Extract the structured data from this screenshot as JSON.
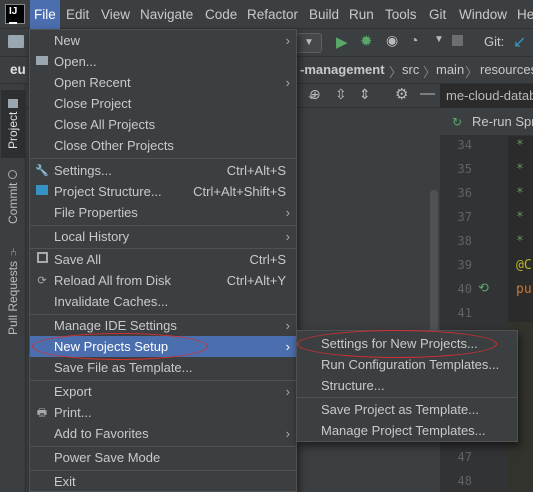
{
  "menubar": {
    "logo": "IJ",
    "items": [
      "File",
      "Edit",
      "View",
      "Navigate",
      "Code",
      "Refactor",
      "Build",
      "Run",
      "Tools",
      "Git",
      "Window",
      "He"
    ]
  },
  "toolbar": {
    "git_label": "Git:"
  },
  "breadcrumbs": {
    "items": [
      "-management",
      "src",
      "main",
      "resources"
    ]
  },
  "project_root": "eu",
  "left_strip": {
    "tabs": [
      "Project",
      "Commit",
      "Pull Requests"
    ]
  },
  "editor": {
    "file_tab": "me-cloud-datab",
    "run_tab": "Re-run Spr",
    "line_numbers": [
      "34",
      "35",
      "36",
      "37",
      "38",
      "39",
      "40",
      "41",
      "47",
      "48"
    ],
    "code_lines": [
      {
        "line": "34",
        "text": "*"
      },
      {
        "line": "35",
        "text": "*"
      },
      {
        "line": "36",
        "text": "*"
      },
      {
        "line": "37",
        "text": "*"
      },
      {
        "line": "38",
        "text": "*"
      },
      {
        "line": "39",
        "text": "@C"
      },
      {
        "line": "40",
        "text": "pu"
      }
    ]
  },
  "file_menu": {
    "items": [
      {
        "label": "New",
        "submenu": true
      },
      {
        "label": "Open...",
        "icon": "folder-icon"
      },
      {
        "label": "Open Recent",
        "submenu": true
      },
      {
        "label": "Close Project"
      },
      {
        "label": "Close All Projects"
      },
      {
        "label": "Close Other Projects"
      },
      {
        "label": "Settings...",
        "shortcut": "Ctrl+Alt+S",
        "icon": "wrench-icon"
      },
      {
        "label": "Project Structure...",
        "shortcut": "Ctrl+Alt+Shift+S",
        "icon": "project-structure-icon"
      },
      {
        "label": "File Properties",
        "submenu": true
      },
      {
        "label": "Local History",
        "submenu": true
      },
      {
        "label": "Save All",
        "shortcut": "Ctrl+S",
        "icon": "save-icon"
      },
      {
        "label": "Reload All from Disk",
        "shortcut": "Ctrl+Alt+Y",
        "icon": "reload-icon"
      },
      {
        "label": "Invalidate Caches..."
      },
      {
        "label": "Manage IDE Settings",
        "submenu": true
      },
      {
        "label": "New Projects Setup",
        "submenu": true,
        "highlighted": true
      },
      {
        "label": "Save File as Template..."
      },
      {
        "label": "Export",
        "submenu": true
      },
      {
        "label": "Print...",
        "icon": "print-icon"
      },
      {
        "label": "Add to Favorites",
        "submenu": true
      },
      {
        "label": "Power Save Mode"
      },
      {
        "label": "Exit"
      }
    ]
  },
  "submenu": {
    "items": [
      {
        "label": "Settings for New Projects..."
      },
      {
        "label": "Run Configuration Templates..."
      },
      {
        "label": "Structure..."
      },
      {
        "label": "Save Project as Template..."
      },
      {
        "label": "Manage Project Templates..."
      }
    ]
  },
  "colors": {
    "highlight": "#4b6eaf",
    "annotation": "#d03030",
    "menu_bg": "#3c3f41"
  }
}
